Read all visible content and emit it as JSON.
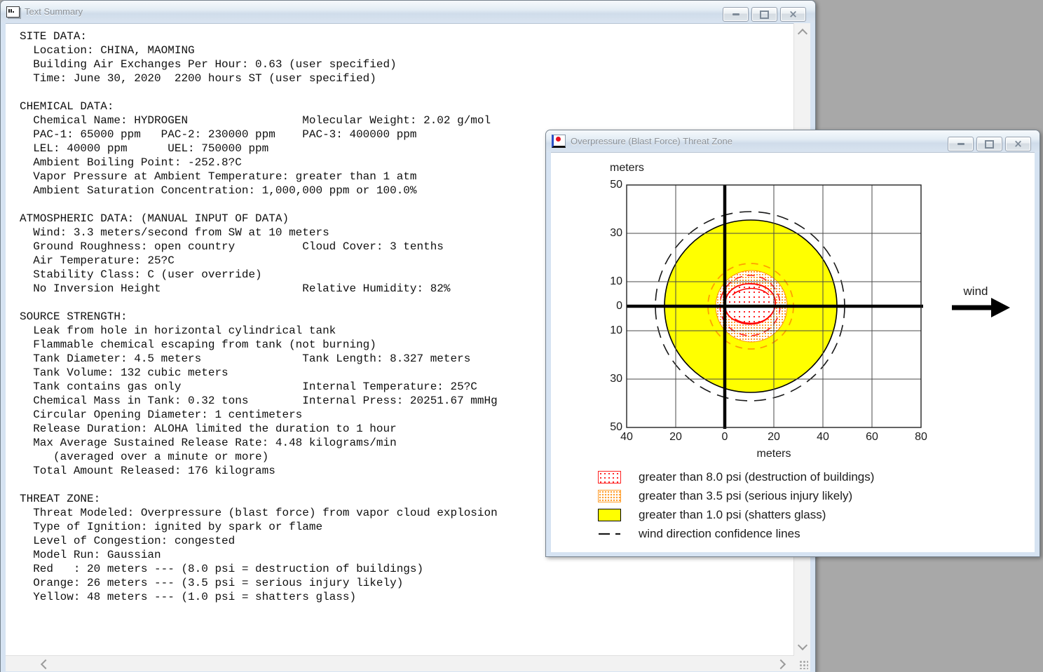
{
  "desktop": {
    "background_color": "#a8a8a8"
  },
  "window_chrome": {
    "minimize_label": "minimize",
    "maximize_label": "maximize",
    "close_label": "close",
    "close_glyph": "×"
  },
  "text_summary_window": {
    "title": "Text Summary",
    "content_lines": [
      "SITE DATA:",
      "  Location: CHINA, MAOMING",
      "  Building Air Exchanges Per Hour: 0.63 (user specified)",
      "  Time: June 30, 2020  2200 hours ST (user specified)",
      "",
      "CHEMICAL DATA:",
      "  Chemical Name: HYDROGEN                 Molecular Weight: 2.02 g/mol",
      "  PAC-1: 65000 ppm   PAC-2: 230000 ppm    PAC-3: 400000 ppm",
      "  LEL: 40000 ppm      UEL: 750000 ppm",
      "  Ambient Boiling Point: -252.8?C",
      "  Vapor Pressure at Ambient Temperature: greater than 1 atm",
      "  Ambient Saturation Concentration: 1,000,000 ppm or 100.0%",
      "",
      "ATMOSPHERIC DATA: (MANUAL INPUT OF DATA)",
      "  Wind: 3.3 meters/second from SW at 10 meters",
      "  Ground Roughness: open country          Cloud Cover: 3 tenths",
      "  Air Temperature: 25?C",
      "  Stability Class: C (user override)",
      "  No Inversion Height                     Relative Humidity: 82%",
      "",
      "SOURCE STRENGTH:",
      "  Leak from hole in horizontal cylindrical tank",
      "  Flammable chemical escaping from tank (not burning)",
      "  Tank Diameter: 4.5 meters               Tank Length: 8.327 meters",
      "  Tank Volume: 132 cubic meters",
      "  Tank contains gas only                  Internal Temperature: 25?C",
      "  Chemical Mass in Tank: 0.32 tons        Internal Press: 20251.67 mmHg",
      "  Circular Opening Diameter: 1 centimeters",
      "  Release Duration: ALOHA limited the duration to 1 hour",
      "  Max Average Sustained Release Rate: 4.48 kilograms/min",
      "     (averaged over a minute or more)",
      "  Total Amount Released: 176 kilograms",
      "",
      "THREAT ZONE:",
      "  Threat Modeled: Overpressure (blast force) from vapor cloud explosion",
      "  Type of Ignition: ignited by spark or flame",
      "  Level of Congestion: congested",
      "  Model Run: Gaussian",
      "  Red   : 20 meters --- (8.0 psi = destruction of buildings)",
      "  Orange: 26 meters --- (3.5 psi = serious injury likely)",
      "  Yellow: 48 meters --- (1.0 psi = shatters glass)"
    ]
  },
  "threat_zone_window": {
    "title": "Overpressure (Blast Force) Threat Zone",
    "wind_label": "wind",
    "y_axis_unit": "meters",
    "x_axis_unit": "meters",
    "y_tick_labels": [
      "50",
      "30",
      "10",
      "0",
      "10",
      "30",
      "50"
    ],
    "x_tick_labels": [
      "40",
      "20",
      "0",
      "20",
      "40",
      "60",
      "80"
    ],
    "legend": [
      {
        "name": "red-zone",
        "label": "greater than 8.0 psi (destruction of buildings)",
        "color": "#ff2020",
        "fill": "red dot hatch"
      },
      {
        "name": "orange-zone",
        "label": "greater than 3.5 psi (serious injury likely)",
        "color": "#ffa030",
        "fill": "orange dot hatch"
      },
      {
        "name": "yellow-zone",
        "label": "greater than 1.0 psi (shatters glass)",
        "color": "#ffff00",
        "fill": "solid yellow"
      },
      {
        "name": "wind-confidence",
        "label": "wind direction confidence lines",
        "color": "#000000",
        "fill": "dashed line"
      }
    ]
  },
  "chart_data": {
    "type": "area",
    "title": "Overpressure (Blast Force) Threat Zone",
    "xlabel": "meters",
    "ylabel": "meters",
    "xlim": [
      -40,
      80
    ],
    "ylim": [
      -50,
      50
    ],
    "x_ticks_m": [
      -40,
      -20,
      0,
      20,
      40,
      60,
      80
    ],
    "y_ticks_m": [
      50,
      30,
      10,
      0,
      -10,
      -30,
      -50
    ],
    "grid": true,
    "legend_position": "bottom",
    "series": [
      {
        "name": "red threat zone",
        "threshold_psi": 8.0,
        "description": "destruction of buildings",
        "downwind_extent_m": 20,
        "approx_center_m": [
          10,
          0
        ],
        "approx_radius_m": 10,
        "style": "white fill with red dot hatch, irregular solid red outline, red dashed confidence ring"
      },
      {
        "name": "orange threat zone",
        "threshold_psi": 3.5,
        "description": "serious injury likely",
        "downwind_extent_m": 26,
        "approx_center_m": [
          10,
          0
        ],
        "approx_radius_m": 15,
        "style": "orange dot hatch disc with orange dashed confidence ring"
      },
      {
        "name": "yellow threat zone",
        "threshold_psi": 1.0,
        "description": "shatters glass",
        "downwind_extent_m": 48,
        "approx_center_m": [
          10,
          0
        ],
        "approx_radius_m": 35,
        "style": "solid yellow disc with black outline"
      },
      {
        "name": "wind direction confidence lines",
        "approx_center_m": [
          10,
          0
        ],
        "approx_radius_m": 39,
        "style": "black dashed circle"
      }
    ],
    "wind_direction": "blowing toward +x (right); arrow labeled wind at right of plot"
  }
}
